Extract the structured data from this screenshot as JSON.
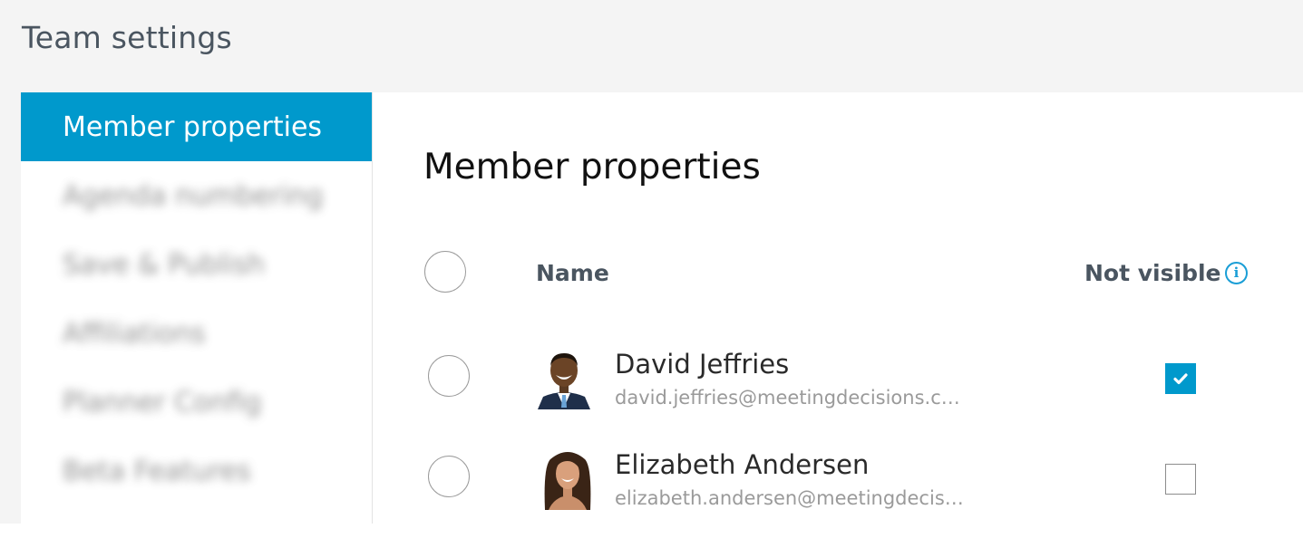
{
  "page": {
    "title": "Team settings"
  },
  "sidebar": {
    "items": [
      {
        "label": "Member properties",
        "active": true
      },
      {
        "label": "Agenda numbering",
        "blurred": true
      },
      {
        "label": "Save & Publish",
        "blurred": true
      },
      {
        "label": "Affiliations",
        "blurred": true
      },
      {
        "label": "Planner Config",
        "blurred": true
      },
      {
        "label": "Beta Features",
        "blurred": true
      }
    ]
  },
  "main": {
    "title": "Member properties",
    "columns": {
      "name": "Name",
      "not_visible": "Not visible"
    },
    "members": [
      {
        "name": "David Jeffries",
        "email": "david.jeffries@meetingdecisions.com",
        "not_visible": true
      },
      {
        "name": "Elizabeth Andersen",
        "email": "elizabeth.andersen@meetingdecisi...",
        "not_visible": false
      }
    ]
  },
  "icons": {
    "info": "info-icon",
    "check": "checkmark-icon"
  },
  "colors": {
    "accent": "#0099cc",
    "info": "#1a9ed6",
    "background": "#f4f4f4"
  }
}
